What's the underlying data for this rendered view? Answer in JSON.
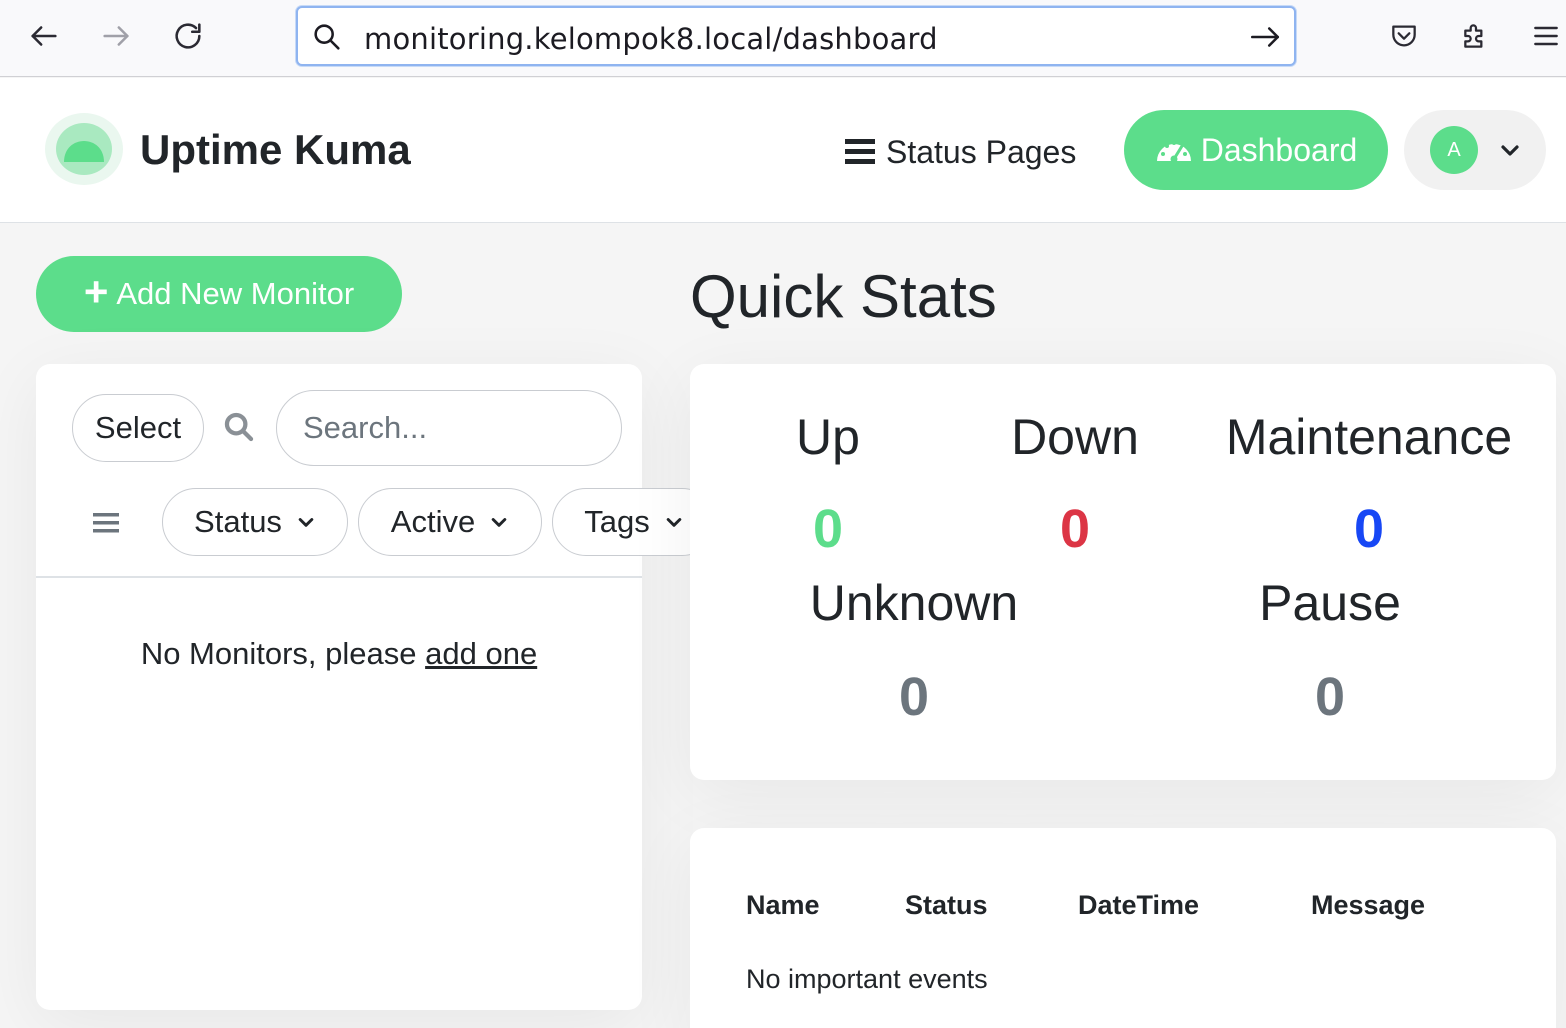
{
  "browser": {
    "url": "monitoring.kelompok8.local/dashboard",
    "back_icon": "arrow-left-icon",
    "forward_icon": "arrow-right-icon",
    "reload_icon": "reload-icon"
  },
  "header": {
    "app_title": "Uptime Kuma",
    "status_pages_label": "Status Pages",
    "dashboard_label": "Dashboard",
    "avatar_initial": "A"
  },
  "sidebar": {
    "add_monitor_label": "Add New Monitor",
    "select_label": "Select",
    "search_placeholder": "Search...",
    "filters": [
      "Status",
      "Active",
      "Tags"
    ],
    "empty_prefix": "No Monitors, please",
    "empty_link": "add one"
  },
  "quick_stats": {
    "title": "Quick Stats",
    "up": {
      "label": "Up",
      "value": "0"
    },
    "down": {
      "label": "Down",
      "value": "0"
    },
    "maintenance": {
      "label": "Maintenance",
      "value": "0"
    },
    "unknown": {
      "label": "Unknown",
      "value": "0"
    },
    "pause": {
      "label": "Pause",
      "value": "0"
    }
  },
  "events": {
    "columns": [
      "Name",
      "Status",
      "DateTime",
      "Message"
    ],
    "empty": "No important events"
  },
  "colors": {
    "accent": "#5cdd8b",
    "up": "#5cdd8b",
    "down": "#dc3545",
    "maintenance": "#1747f5",
    "neutral": "#6c757d"
  }
}
